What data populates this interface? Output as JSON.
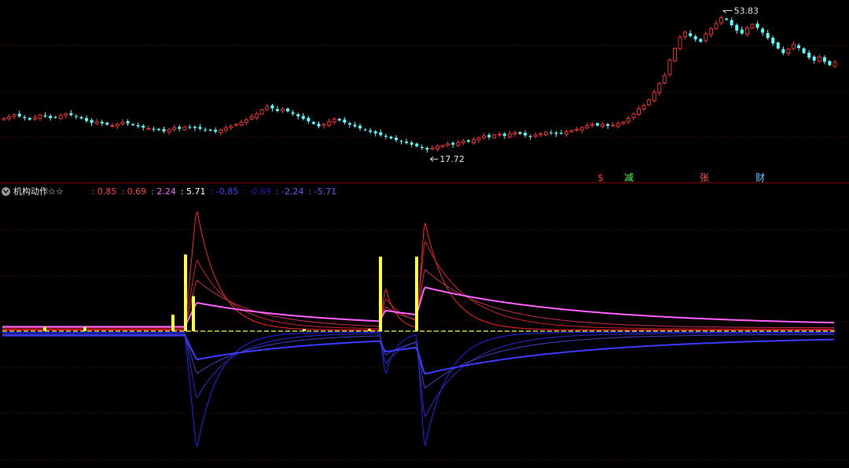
{
  "colors": {
    "background": "#000000",
    "grid": "#5a0000",
    "up": "#ff3232",
    "down": "#54ffff",
    "signal": "#ffff40",
    "pink": "#ff60ff",
    "blue": "#3b3bff",
    "title": "#e6e6e6"
  },
  "indicator": {
    "name": "机构动作☆☆",
    "icon": "chevron-down-icon",
    "values": [
      {
        "text": ": 0.85",
        "color": "#ff4040"
      },
      {
        "text": ": 0.69",
        "color": "#ff4040"
      },
      {
        "text": ": 2.24",
        "color": "#ff60ff"
      },
      {
        "text": ": 5.71",
        "color": "#ffffff"
      },
      {
        "text": ": -0.85",
        "color": "#4040ff"
      },
      {
        "text": ": -0.69",
        "color": "#1c1ca8"
      },
      {
        "text": ": -2.24",
        "color": "#5f5fff"
      },
      {
        "text": ": -5.71",
        "color": "#5f5fff"
      }
    ]
  },
  "chart_data": [
    {
      "type": "candlestick",
      "ylim": [
        15,
        56
      ],
      "annotations": [
        {
          "text": "53.83",
          "marks": "high"
        },
        {
          "text": "17.72",
          "marks": "low"
        }
      ],
      "markers": [
        {
          "text": "$",
          "color": "#ff3030"
        },
        {
          "text": "减",
          "color": "#40ff40"
        },
        {
          "text": "张",
          "color": "#ff5050"
        },
        {
          "text": "财",
          "color": "#60c8ff"
        }
      ],
      "close": [
        28.5,
        28.9,
        29.4,
        29.0,
        28.6,
        28.2,
        28.8,
        29.3,
        29.0,
        28.6,
        28.7,
        29.2,
        29.6,
        29.3,
        28.9,
        28.5,
        27.9,
        27.4,
        27.7,
        27.3,
        27.0,
        26.8,
        27.1,
        27.6,
        27.3,
        26.9,
        26.6,
        26.3,
        26.1,
        25.9,
        25.7,
        25.4,
        25.8,
        26.3,
        26.0,
        26.5,
        26.4,
        26.2,
        26.0,
        25.8,
        25.6,
        25.3,
        25.7,
        26.2,
        26.6,
        27.1,
        27.6,
        28.2,
        28.9,
        29.6,
        30.6,
        31.4,
        30.9,
        30.3,
        30.7,
        30.2,
        29.6,
        29.0,
        28.4,
        27.8,
        27.2,
        26.6,
        27.1,
        27.7,
        28.3,
        28.0,
        27.5,
        27.0,
        26.6,
        26.1,
        25.7,
        25.3,
        24.9,
        24.5,
        24.1,
        23.7,
        23.3,
        23.0,
        22.6,
        22.2,
        21.8,
        21.4,
        21.0,
        21.4,
        21.8,
        22.0,
        22.4,
        22.2,
        22.7,
        23.1,
        22.9,
        23.4,
        23.8,
        24.3,
        24.0,
        24.5,
        24.7,
        24.3,
        24.8,
        25.1,
        24.8,
        24.4,
        24.1,
        24.5,
        24.8,
        25.2,
        25.0,
        24.8,
        24.9,
        25.3,
        25.6,
        25.9,
        26.3,
        26.8,
        27.1,
        26.8,
        27.1,
        26.7,
        26.9,
        27.3,
        27.6,
        28.5,
        29.6,
        30.8,
        31.6,
        33.0,
        34.8,
        36.9,
        38.8,
        42.5,
        45.3,
        48.0,
        49.2,
        48.3,
        47.5,
        46.9,
        48.8,
        50.1,
        51.3,
        52.7,
        52.2,
        50.9,
        49.6,
        48.9,
        50.2,
        51.1,
        50.3,
        49.1,
        47.8,
        46.5,
        45.3,
        44.2,
        45.1,
        46.3,
        45.4,
        44.2,
        43.1,
        42.4,
        43.2,
        42.1,
        41.3,
        42.0
      ]
    },
    {
      "type": "line",
      "ylim": [
        -6.5,
        6.5
      ],
      "events": [
        {
          "start": 235,
          "end": 250,
          "peak": 5.7
        },
        {
          "start": 483,
          "end": 490,
          "peak": 2.2
        },
        {
          "start": 530,
          "end": 540,
          "peak": 5.71
        }
      ],
      "series": [
        {
          "values": [
            0.85,
            0.69,
            2.24,
            5.71
          ]
        },
        {
          "values": [
            -0.85,
            -0.69,
            -2.24,
            -5.71
          ]
        }
      ],
      "bars": [
        {
          "x": 57,
          "value": 0.2
        },
        {
          "x": 108,
          "value": 0.2
        },
        {
          "x": 220,
          "value": 0.75
        },
        {
          "x": 236,
          "value": 3.5
        },
        {
          "x": 246,
          "value": 1.6
        },
        {
          "x": 484,
          "value": 3.4
        },
        {
          "x": 530,
          "value": 3.4
        },
        {
          "x": 387,
          "value": 0.1
        },
        {
          "x": 470,
          "value": 0.1
        }
      ]
    }
  ]
}
